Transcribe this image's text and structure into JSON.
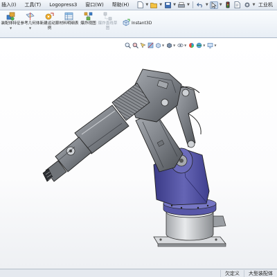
{
  "menubar": {
    "items": [
      "插入(I)",
      "工具(T)",
      "Logopress3",
      "窗口(W)",
      "帮助(H)"
    ],
    "window_title": "工业机"
  },
  "commands": [
    {
      "label": "装配体特征",
      "icon": "assembly-feature-icon",
      "dropdown": true,
      "disabled": false
    },
    {
      "label": "参考几何体",
      "icon": "reference-geometry-icon",
      "dropdown": true,
      "disabled": false
    },
    {
      "label": "新建运动算例",
      "icon": "new-motion-study-icon",
      "dropdown": false,
      "disabled": false
    },
    {
      "label": "材料明细表",
      "icon": "bom-icon",
      "dropdown": false,
      "disabled": false
    },
    {
      "label": "爆炸视图",
      "icon": "exploded-view-icon",
      "dropdown": false,
      "disabled": false
    },
    {
      "label": "爆炸直线草图",
      "icon": "explode-line-sketch-icon",
      "dropdown": false,
      "disabled": true
    }
  ],
  "instant3d": {
    "label": "Instant3D"
  },
  "status": {
    "left": "欠定义",
    "right": "大型装配体"
  },
  "colors": {
    "base_purple": "#5a5aa8",
    "arm_gray": "#8c8f94",
    "background": "#ffffff"
  }
}
